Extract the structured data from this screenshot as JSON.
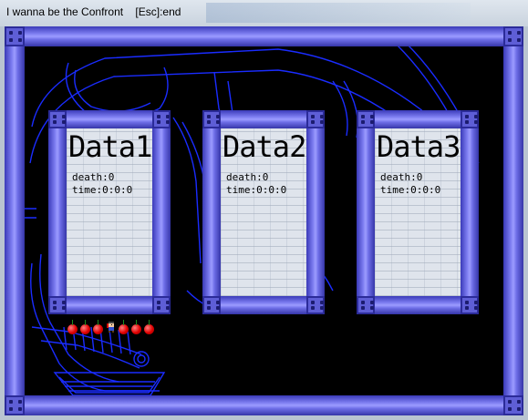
{
  "window": {
    "title": "I wanna be the Confront    [Esc]:end"
  },
  "save_slots": [
    {
      "name": "Data1",
      "death_label": "death:0",
      "time_label": "time:0:0:0"
    },
    {
      "name": "Data2",
      "death_label": "death:0",
      "time_label": "time:0:0:0"
    },
    {
      "name": "Data3",
      "death_label": "death:0",
      "time_label": "time:0:0:0"
    }
  ],
  "colors": {
    "frame_purple": "#7b7bef",
    "background_art": "#1a1aff",
    "cherry_red": "#e00000"
  },
  "icons": [
    "cherry-icon",
    "kid-player-icon"
  ]
}
